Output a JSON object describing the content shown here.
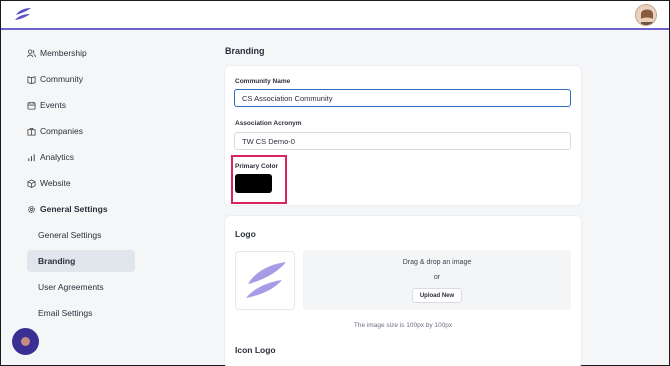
{
  "topbar": {
    "logo_icon": "feather-logo-icon",
    "avatar_icon": "user-avatar"
  },
  "sidebar": {
    "items": [
      {
        "label": "Membership",
        "icon": "users-icon"
      },
      {
        "label": "Community",
        "icon": "book-icon"
      },
      {
        "label": "Events",
        "icon": "calendar-icon"
      },
      {
        "label": "Companies",
        "icon": "building-icon"
      },
      {
        "label": "Analytics",
        "icon": "bar-chart-icon"
      },
      {
        "label": "Website",
        "icon": "cube-icon"
      },
      {
        "label": "General Settings",
        "icon": "gear-icon"
      }
    ],
    "subitems": [
      {
        "label": "General Settings",
        "active": false
      },
      {
        "label": "Branding",
        "active": true
      },
      {
        "label": "User Agreements",
        "active": false
      },
      {
        "label": "Email Settings",
        "active": false
      }
    ]
  },
  "main": {
    "title": "Branding",
    "community_name_label": "Community Name",
    "community_name_value": "CS Association Community",
    "acronym_label": "Association Acronym",
    "acronym_value": "TW CS Demo-0",
    "primary_color_label": "Primary Color",
    "primary_color_value": "#000000",
    "logo_title": "Logo",
    "dropzone_text": "Drag & drop an image",
    "dropzone_or": "or",
    "upload_button": "Upload New",
    "size_hint": "The image size is 100px by 100px",
    "icon_logo_title": "Icon Logo"
  },
  "colors": {
    "accent": "#6e63cc",
    "focus": "#2e6cbf",
    "highlight": "#d9245b",
    "fab": "#3a2f93"
  }
}
